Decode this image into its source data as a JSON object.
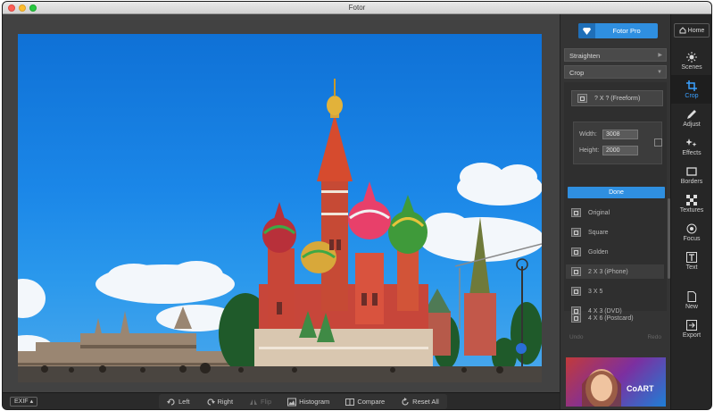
{
  "window": {
    "title": "Fotor"
  },
  "header": {
    "pro_label": "Fotor Pro"
  },
  "panel": {
    "straighten_label": "Straighten",
    "crop_label": "Crop",
    "freeform_label": "? X ? (Freeform)",
    "width_label": "Width:",
    "width_value": "3008",
    "height_label": "Height:",
    "height_value": "2000",
    "done_label": "Done",
    "crop_options": [
      {
        "label": "Original"
      },
      {
        "label": "Square"
      },
      {
        "label": "Golden"
      },
      {
        "label": "2 X 3 (iPhone)"
      },
      {
        "label": "3 X 5"
      },
      {
        "label": "4 X 3 (DVD)"
      },
      {
        "label": "4 X 6 (Postcard)"
      }
    ],
    "undo_label": "Undo",
    "redo_label": "Redo",
    "thumb_text": "CoART"
  },
  "rail": {
    "home_label": "Home",
    "items": [
      {
        "label": "Scenes",
        "icon": "sun-icon"
      },
      {
        "label": "Crop",
        "icon": "crop-icon",
        "active": true
      },
      {
        "label": "Adjust",
        "icon": "pencil-icon"
      },
      {
        "label": "Effects",
        "icon": "sparkle-icon"
      },
      {
        "label": "Borders",
        "icon": "frame-icon"
      },
      {
        "label": "Textures",
        "icon": "checker-icon"
      },
      {
        "label": "Focus",
        "icon": "target-icon"
      },
      {
        "label": "Text",
        "icon": "text-icon"
      },
      {
        "label": "New",
        "icon": "new-file-icon"
      },
      {
        "label": "Export",
        "icon": "export-icon"
      }
    ]
  },
  "bottombar": {
    "exif_label": "EXIF",
    "left_label": "Left",
    "right_label": "Right",
    "flip_label": "Flip",
    "histogram_label": "Histogram",
    "compare_label": "Compare",
    "reset_label": "Reset  All"
  },
  "colors": {
    "accent": "#2f8fe0",
    "sky": "#1b87e8",
    "active_rail": "#3aa0ff"
  }
}
